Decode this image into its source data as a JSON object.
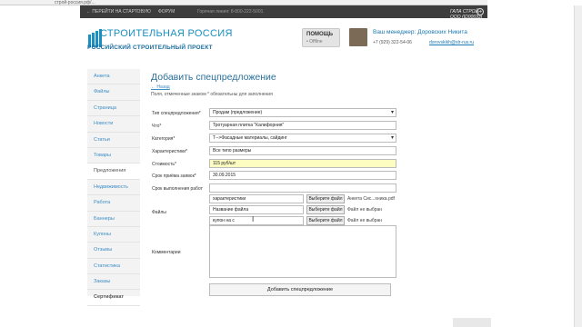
{
  "browser": {
    "url": "строй-россия.рф/..."
  },
  "topbar": {
    "back_label": "← ПЕРЕЙТИ НА СТАРТОВУЮ",
    "forum_label": "ФОРУМ",
    "hotline": "Горячая линия: 8-800-222-5001",
    "company": "ГАЛА СТРОЙ, ООО (ID00693)",
    "exit_icon": "exit-icon"
  },
  "header": {
    "logo_title": "СТРОИТЕЛЬНАЯ РОССИЯ",
    "logo_subtitle": "РОССИЙСКИЙ СТРОИТЕЛЬНЫЙ ПРОЕКТ",
    "help_label": "ПОМОЩЬ",
    "help_status": "• Offline",
    "manager_label": "Ваш менеджер: Доровских Никита",
    "manager_phone": "+7 (929) 322-54-06",
    "manager_email": "dorovskikh@str-rus.ru"
  },
  "sidebar": {
    "items": [
      {
        "label": "Анкета"
      },
      {
        "label": "Файлы"
      },
      {
        "label": "Страница"
      },
      {
        "label": "Новости"
      },
      {
        "label": "Статьи"
      },
      {
        "label": "Товары"
      },
      {
        "label": "Предложения"
      },
      {
        "label": "Недвижимость"
      },
      {
        "label": "Работа"
      },
      {
        "label": "Баннеры"
      },
      {
        "label": "Купоны"
      },
      {
        "label": "Отзывы"
      },
      {
        "label": "Статистика"
      },
      {
        "label": "Заказы"
      },
      {
        "label": "Сертификат"
      }
    ]
  },
  "form": {
    "title": "Добавить спецпредложение",
    "back_link": "← Назад",
    "required_note": "Поля, отмеченные знаком * обязательны для заполнения",
    "type_label": "Тип спецпредложения*",
    "type_value": "Продам (предложение)",
    "what_label": "Что*",
    "what_value": "Тротуарная плитка \"Калифорния\"",
    "category_label": "Категория*",
    "category_value": "Т-->Фасадные материалы, сайдинг",
    "specs_label": "Характеристики*",
    "specs_value": "Все типо размеры",
    "price_label": "Стоимость*",
    "price_value": "115 руб/шт",
    "deadline_label": "Срок приёма заявок*",
    "deadline_value": "30.09.2015",
    "work_term_label": "Срок выполнения работ",
    "work_term_value": "",
    "files_label": "Файлы",
    "files": [
      {
        "name": "характеристики",
        "button": "Выберите файл",
        "status": "Анкета Сис...хника.pdf"
      },
      {
        "name": "Название файла",
        "button": "Выберите файл",
        "status": "Файл не выбран"
      },
      {
        "name": "купон на с",
        "button": "Выберите файл",
        "status": "Файл не выбран"
      }
    ],
    "comments_label": "Комментарии",
    "submit_label": "Добавить спецпредложение"
  }
}
